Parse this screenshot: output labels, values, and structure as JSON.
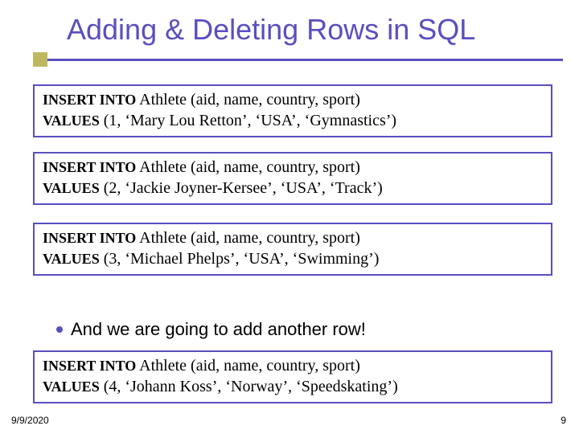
{
  "title": "Adding & Deleting Rows in SQL",
  "sql": {
    "kw_insert": "INSERT INTO",
    "kw_values": "VALUES",
    "box1_l1": " Athlete (aid, name, country, sport)",
    "box1_l2": "  (1, ‘Mary Lou Retton’, ‘USA’, ‘Gymnastics’)",
    "box2_l1": " Athlete (aid, name, country, sport)",
    "box2_l2": "  (2, ‘Jackie Joyner-Kersee’, ‘USA’, ‘Track’)",
    "box3_l1": " Athlete (aid, name, country, sport)",
    "box3_l2": "  (3, ‘Michael Phelps’, ‘USA’, ‘Swimming’)",
    "box4_l1": " Athlete (aid, name, country, sport)",
    "box4_l2": "  (4, ‘Johann Koss’, ‘Norway’, ‘Speedskating’)"
  },
  "bullet": "And we are going to add another row!",
  "footer": {
    "date": "9/9/2020",
    "page": "9"
  }
}
